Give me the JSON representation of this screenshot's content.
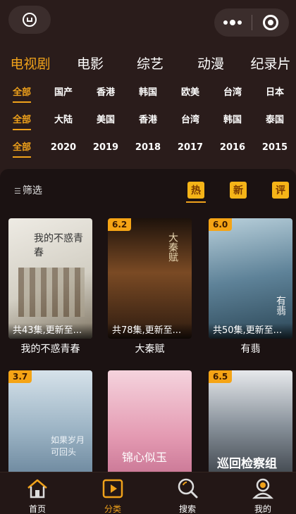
{
  "category_tabs": [
    "电视剧",
    "电影",
    "综艺",
    "动漫",
    "纪录片"
  ],
  "active_category": "电视剧",
  "filters": {
    "type": [
      "全部",
      "国产",
      "香港",
      "韩国",
      "欧美",
      "台湾",
      "日本"
    ],
    "region": [
      "全部",
      "大陆",
      "美国",
      "香港",
      "台湾",
      "韩国",
      "泰国"
    ],
    "year": [
      "全部",
      "2020",
      "2019",
      "2018",
      "2017",
      "2016",
      "2015"
    ]
  },
  "sort_bar": {
    "filter_label": "筛选",
    "hot": "热",
    "new": "新",
    "rated": "评"
  },
  "cards": [
    {
      "title": "我的不惑青春",
      "episodes": "共43集,更新至...",
      "rating": "",
      "art_text": "我的不惑青春",
      "colors": [
        "#e9e6df",
        "#c9c6bb",
        "#8a8270"
      ]
    },
    {
      "title": "大秦赋",
      "episodes": "共78集,更新至...",
      "rating": "6.2",
      "art_text": "大秦赋",
      "colors": [
        "#2a1a10",
        "#6a3d1f",
        "#3a2414"
      ]
    },
    {
      "title": "有翡",
      "episodes": "共50集,更新至...",
      "rating": "6.0",
      "art_text": "有翡",
      "colors": [
        "#9fb9c6",
        "#4f7287",
        "#2a4454"
      ]
    },
    {
      "title": "",
      "episodes": "",
      "rating": "3.7",
      "art_text": "如果岁月可回头",
      "colors": [
        "#c8d7e2",
        "#8fa8bb",
        "#5e7a92"
      ]
    },
    {
      "title": "",
      "episodes": "",
      "rating": "",
      "art_text": "锦心似玉",
      "colors": [
        "#f1c6d2",
        "#e49ab2",
        "#c86d8e"
      ]
    },
    {
      "title": "",
      "episodes": "",
      "rating": "6.5",
      "art_text": "巡回检察组",
      "colors": [
        "#dfe2e6",
        "#7a848f",
        "#2f353c"
      ]
    }
  ],
  "bottom_nav": [
    {
      "label": "首页",
      "icon": "home-icon"
    },
    {
      "label": "分类",
      "icon": "category-play-icon"
    },
    {
      "label": "搜索",
      "icon": "search-icon"
    },
    {
      "label": "我的",
      "icon": "profile-icon"
    }
  ],
  "active_nav": "分类",
  "colors": {
    "accent": "#f0a21b",
    "badge": "#f5b418",
    "background": "#2a1c1b",
    "panel": "#1b1212"
  }
}
